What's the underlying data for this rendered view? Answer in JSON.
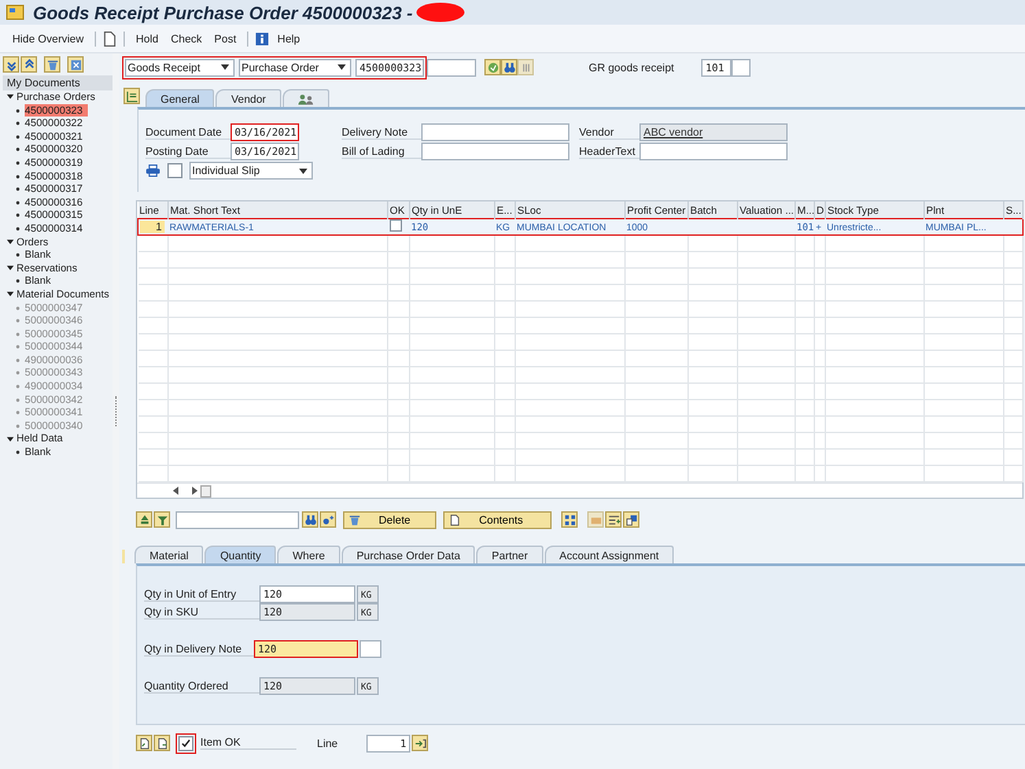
{
  "window": {
    "title": "Goods Receipt Purchase Order 4500000323 -"
  },
  "toolbar": {
    "overview": "Hide Overview",
    "actions": [
      "Hold",
      "Check",
      "Post"
    ],
    "help": "Help"
  },
  "sidebar": {
    "header": "My Documents",
    "groups": [
      {
        "label": "Purchase Orders",
        "expanded": true,
        "dimmed": false,
        "children": [
          {
            "label": "4500000323",
            "selected": true
          },
          {
            "label": "4500000322",
            "selected": false
          },
          {
            "label": "4500000321",
            "selected": false
          },
          {
            "label": "4500000320",
            "selected": false
          },
          {
            "label": "4500000319",
            "selected": false
          },
          {
            "label": "4500000318",
            "selected": false
          },
          {
            "label": "4500000317",
            "selected": false
          },
          {
            "label": "4500000316",
            "selected": false
          },
          {
            "label": "4500000315",
            "selected": false
          },
          {
            "label": "4500000314",
            "selected": false
          }
        ]
      },
      {
        "label": "Orders",
        "expanded": true,
        "dimmed": false,
        "children": [
          {
            "label": "Blank",
            "selected": false
          }
        ]
      },
      {
        "label": "Reservations",
        "expanded": true,
        "dimmed": false,
        "children": [
          {
            "label": "Blank",
            "selected": false
          }
        ]
      },
      {
        "label": "Material Documents",
        "expanded": true,
        "dimmed": true,
        "children": [
          {
            "label": "5000000347",
            "selected": false
          },
          {
            "label": "5000000346",
            "selected": false
          },
          {
            "label": "5000000345",
            "selected": false
          },
          {
            "label": "5000000344",
            "selected": false
          },
          {
            "label": "4900000036",
            "selected": false
          },
          {
            "label": "5000000343",
            "selected": false
          },
          {
            "label": "4900000034",
            "selected": false
          },
          {
            "label": "5000000342",
            "selected": false
          },
          {
            "label": "5000000341",
            "selected": false
          },
          {
            "label": "5000000340",
            "selected": false
          }
        ]
      },
      {
        "label": "Held Data",
        "expanded": true,
        "dimmed": false,
        "children": [
          {
            "label": "Blank",
            "selected": false
          }
        ]
      }
    ]
  },
  "selection": {
    "transaction": "Goods Receipt",
    "reference": "Purchase Order",
    "number": "4500000323",
    "highlighted": true,
    "movement_label": "GR goods receipt",
    "movement_type": "101"
  },
  "header_tabs": [
    {
      "kind": "text",
      "label": "General",
      "selected": true
    },
    {
      "kind": "text",
      "label": "Vendor",
      "selected": false
    },
    {
      "kind": "icon",
      "selected": false
    }
  ],
  "header": {
    "document_date": {
      "label": "Document Date",
      "value": "03/16/2021",
      "highlighted": true
    },
    "posting_date": {
      "label": "Posting Date",
      "value": "03/16/2021",
      "highlighted": false
    },
    "slip": {
      "checked": false,
      "value": "Individual Slip"
    },
    "delivery_note": {
      "label": "Delivery Note"
    },
    "bill_of_lading": {
      "label": "Bill of Lading"
    },
    "vendor": {
      "label": "Vendor",
      "value": "ABC vendor"
    },
    "header_text": {
      "label": "HeaderText"
    }
  },
  "items_table": {
    "columns": [
      "Line",
      "Mat. Short Text",
      "OK",
      "Qty in UnE",
      "E...",
      "SLoc",
      "Profit Center",
      "Batch",
      "Valuation ...",
      "M...",
      "D",
      "Stock Type",
      "Plnt",
      "S..."
    ],
    "rows": [
      {
        "highlighted": true,
        "ok": false,
        "cells": [
          "1",
          "RAWMATERIALS-1",
          null,
          "120",
          "KG",
          "MUMBAI LOCATION",
          "1000",
          null,
          null,
          "101",
          "+",
          "Unrestricte...",
          "MUMBAI PL...",
          null
        ]
      }
    ]
  },
  "item_toolbar": {
    "buttons": [
      "Delete",
      "Contents"
    ]
  },
  "item_tabs": [
    {
      "label": "Material",
      "selected": false
    },
    {
      "label": "Quantity",
      "selected": true
    },
    {
      "label": "Where",
      "selected": false
    },
    {
      "label": "Purchase Order Data",
      "selected": false
    },
    {
      "label": "Partner",
      "selected": false
    },
    {
      "label": "Account Assignment",
      "selected": false
    }
  ],
  "quantity": [
    {
      "kind": "input",
      "label": "Qty in Unit of Entry",
      "value": "120",
      "unit": "KG",
      "highlighted": false
    },
    {
      "kind": "readonly",
      "label": "Qty in SKU",
      "value": "120",
      "unit": "KG",
      "highlighted": false
    },
    {
      "kind": "active",
      "label": "Qty in Delivery Note",
      "value": "120",
      "highlighted": true
    },
    {
      "kind": "readonly",
      "label": "Quantity Ordered",
      "value": "120",
      "unit": "KG",
      "highlighted": false
    }
  ],
  "footer": {
    "item_ok": {
      "label": "Item OK",
      "checked": true,
      "highlighted": true
    },
    "line_label": "Line",
    "line_value": "1"
  }
}
